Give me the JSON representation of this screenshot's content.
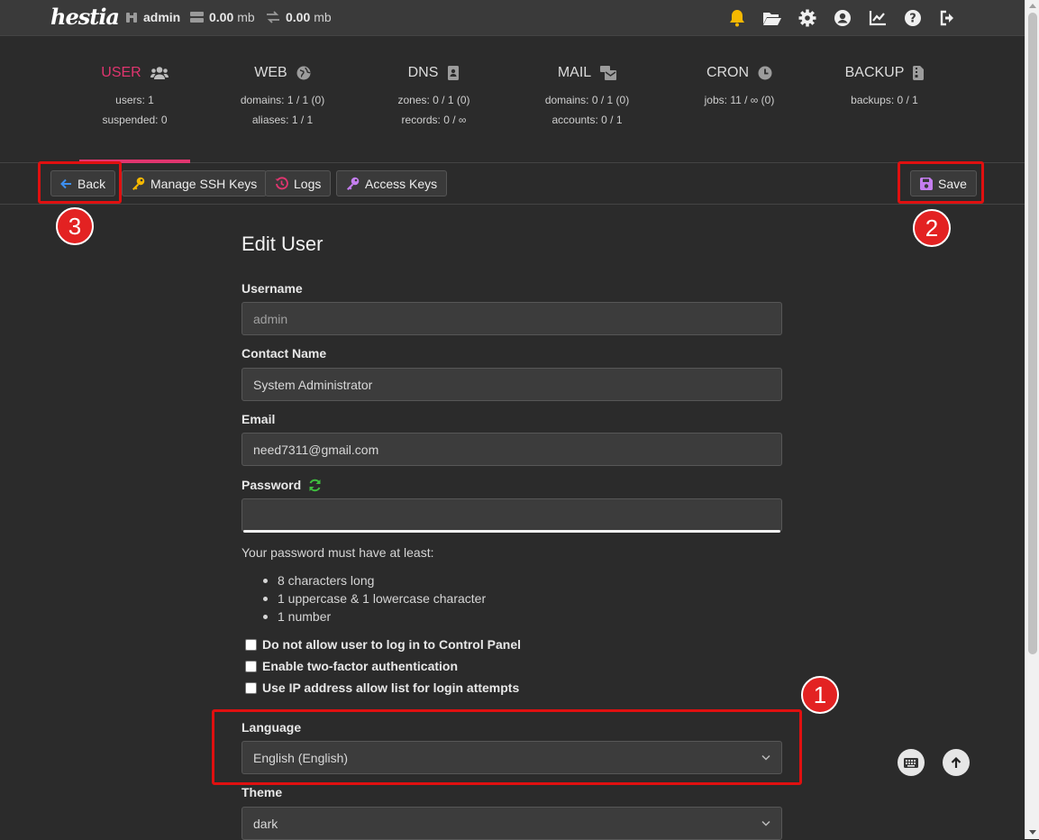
{
  "topbar": {
    "logo": "hestia",
    "user": "admin",
    "disk_value": "0.00",
    "disk_unit": "mb",
    "bandwidth_value": "0.00",
    "bandwidth_unit": "mb",
    "icons": [
      "bell-icon",
      "folder-open-icon",
      "gear-icon",
      "user-circle-icon",
      "chart-line-icon",
      "question-icon",
      "logout-icon"
    ]
  },
  "nav": [
    {
      "title": "USER",
      "icon": "users-icon",
      "stats": [
        "users: 1",
        "suspended: 0"
      ]
    },
    {
      "title": "WEB",
      "icon": "globe-icon",
      "stats": [
        "domains: 1 / 1 (0)",
        "aliases: 1 / 1"
      ]
    },
    {
      "title": "DNS",
      "icon": "address-book-icon",
      "stats": [
        "zones: 0 / 1 (0)",
        "records: 0 / ∞"
      ]
    },
    {
      "title": "MAIL",
      "icon": "mail-bulk-icon",
      "stats": [
        "domains: 0 / 1 (0)",
        "accounts: 0 / 1"
      ]
    },
    {
      "title": "CRON",
      "icon": "clock-icon",
      "stats": [
        "jobs: 11 / ∞ (0)"
      ]
    },
    {
      "title": "BACKUP",
      "icon": "file-archive-icon",
      "stats": [
        "backups: 0 / 1"
      ]
    }
  ],
  "toolbar": {
    "back": "Back",
    "ssh_keys": "Manage SSH Keys",
    "logs": "Logs",
    "access_keys": "Access Keys",
    "save": "Save"
  },
  "badges": [
    "1",
    "2",
    "3"
  ],
  "form": {
    "title": "Edit User",
    "username_label": "Username",
    "username_placeholder": "admin",
    "contact_label": "Contact Name",
    "contact_value": "System Administrator",
    "email_label": "Email",
    "email_value": "need7311@gmail.com",
    "password_label": "Password",
    "password_value": "",
    "password_hint": "Your password must have at least:",
    "password_reqs": [
      "8 characters long",
      "1 uppercase & 1 lowercase character",
      "1 number"
    ],
    "checks": [
      "Do not allow user to log in to Control Panel",
      "Enable two-factor authentication",
      "Use IP address allow list for login attempts"
    ],
    "language_label": "Language",
    "language_value": "English (English)",
    "theme_label": "Theme",
    "theme_value": "dark"
  },
  "colors": {
    "accent": "#e0356f",
    "highlight": "#e01010",
    "refresh_green": "#3fbf3f"
  }
}
